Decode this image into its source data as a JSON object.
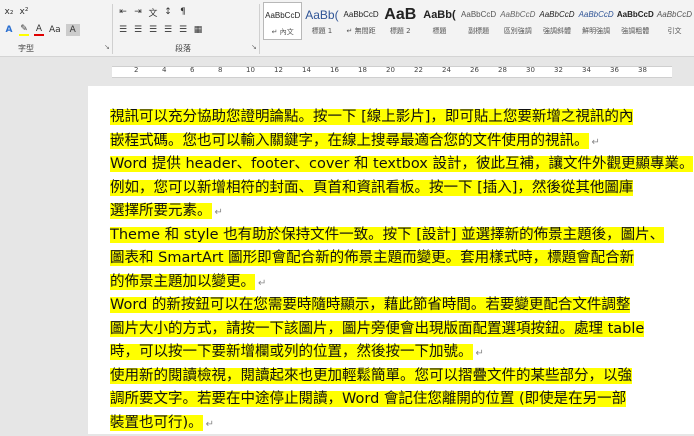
{
  "ribbon": {
    "font_row1": [
      "x₂",
      "x²"
    ],
    "font_row2": [
      "A",
      "A",
      "Aa",
      "A"
    ],
    "para_row1": [
      "☰",
      "☰",
      "☰",
      "☰",
      "☰",
      "▦"
    ],
    "groups": {
      "font": "字型",
      "paragraph": "段落"
    },
    "styles": [
      {
        "sample": "AaBbCcD",
        "name": "↵ 內文"
      },
      {
        "sample": "AaBb(",
        "name": "標題 1"
      },
      {
        "sample": "AaBbCcD",
        "name": "↵ 無間距"
      },
      {
        "sample": "AaB",
        "name": "標題 2"
      },
      {
        "sample": "AaBb(",
        "name": "標題"
      },
      {
        "sample": "AaBbCcD",
        "name": "副標題"
      },
      {
        "sample": "AaBbCcD",
        "name": "區別強調"
      },
      {
        "sample": "AaBbCcD",
        "name": "強調斜體"
      },
      {
        "sample": "AaBbCcD",
        "name": "鮮明強調"
      },
      {
        "sample": "AaBbCcD",
        "name": "強調粗體"
      },
      {
        "sample": "AaBbCcD",
        "name": "引文"
      }
    ],
    "colors": {
      "highlight": "#ffff00",
      "font_color": "#e00000"
    }
  },
  "ruler": [
    "2",
    "4",
    "6",
    "8",
    "10",
    "12",
    "14",
    "16",
    "18",
    "20",
    "22",
    "24",
    "26",
    "28",
    "30",
    "32",
    "34",
    "36",
    "38"
  ],
  "document": {
    "lines": [
      "視訊可以充分協助您證明論點。按一下 [線上影片]，即可貼上您要新增之視訊的內",
      "嵌程式碼。您也可以輸入關鍵字，在線上搜尋最適合您的文件使用的視訊。",
      "Word 提供 header、footer、cover 和 textbox 設計，彼此互補，讓文件外觀更顯專業。",
      "例如，您可以新增相符的封面、頁首和資訊看板。按一下 [插入]，然後從其他圖庫",
      "選擇所要元素。",
      "Theme 和 style 也有助於保持文件一致。按下 [設計] 並選擇新的佈景主題後，圖片、",
      "圖表和 SmartArt 圖形即會配合新的佈景主題而變更。套用樣式時，標題會配合新",
      "的佈景主題加以變更。",
      "Word 的新按鈕可以在您需要時隨時顯示，藉此節省時間。若要變更配合文件調整",
      "圖片大小的方式，請按一下該圖片，圖片旁便會出現版面配置選項按鈕。處理 table",
      "時，可以按一下要新增欄或列的位置，然後按一下加號。",
      "使用新的閱讀檢視，閱讀起來也更加輕鬆簡單。您可以摺疊文件的某些部分，以強",
      "調所要文字。若要在中途停止閱讀，Word 會記住您離開的位置 (即使是在另一部",
      "裝置也可行)。"
    ],
    "para_end_lines": [
      1,
      4,
      7,
      10,
      13
    ]
  }
}
